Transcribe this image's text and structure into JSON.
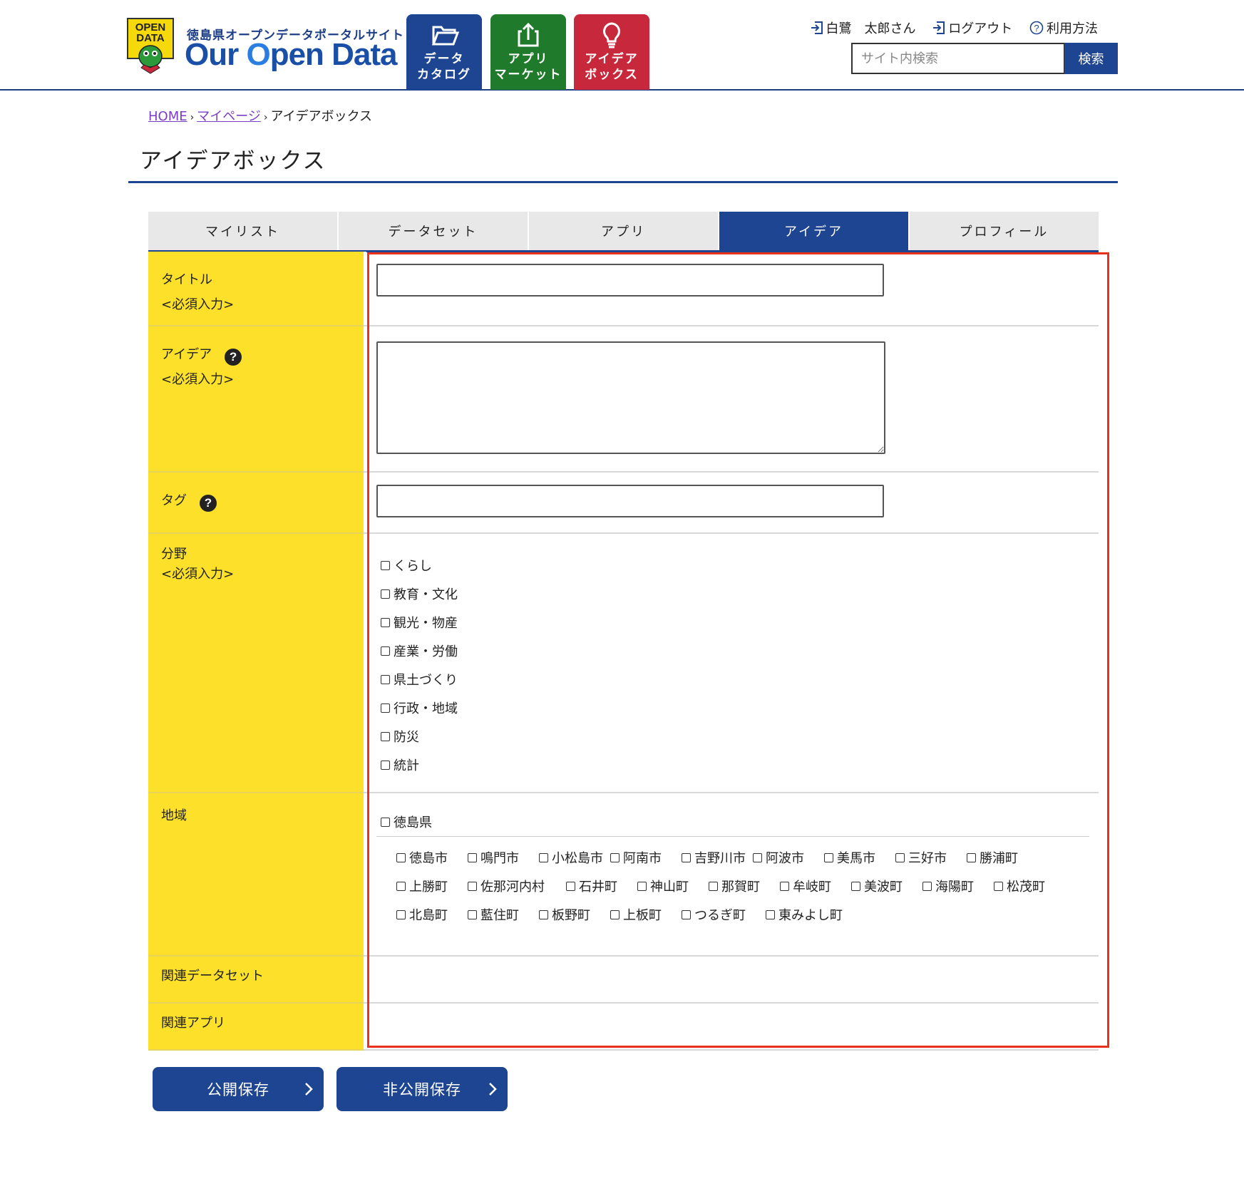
{
  "header": {
    "logo_badge": "OPEN DATA",
    "logo_subtitle": "徳島県オープンデータポータルサイト",
    "logo_title_a": "Our ",
    "logo_title_b": "O",
    "logo_title_c": "pen Data",
    "nav": [
      {
        "label": "データ\nカタログ",
        "icon": "folder-icon",
        "color": "#1d4592"
      },
      {
        "label": "アプリ\nマーケット",
        "icon": "share-icon",
        "color": "#1f7a2c"
      },
      {
        "label": "アイデア\nボックス",
        "icon": "lightbulb-icon",
        "color": "#c8283c"
      }
    ],
    "user_name": "白鷺　太郎さん",
    "logout": "ログアウト",
    "help": "利用方法",
    "search": {
      "placeholder": "サイト内検索",
      "button": "検索"
    }
  },
  "breadcrumb": {
    "home": "HOME",
    "mypage": "マイページ",
    "current": "アイデアボックス"
  },
  "page_title": "アイデアボックス",
  "tabs": [
    "マイリスト",
    "データセット",
    "アプリ",
    "アイデア",
    "プロフィール"
  ],
  "active_tab": "アイデア",
  "form": {
    "title_label": "タイトル",
    "required": "<必須入力>",
    "idea_label": "アイデア",
    "tag_label": "タグ",
    "field_label": "分野",
    "fields": [
      "くらし",
      "教育・文化",
      "観光・物産",
      "産業・労働",
      "県土づくり",
      "行政・地域",
      "防災",
      "統計"
    ],
    "region_label": "地域",
    "prefecture": "徳島県",
    "municipalities": [
      "徳島市",
      "鳴門市",
      "小松島市",
      "阿南市",
      "吉野川市",
      "阿波市",
      "美馬市",
      "三好市",
      "勝浦町",
      "上勝町",
      "佐那河内村",
      "石井町",
      "神山町",
      "那賀町",
      "牟岐町",
      "美波町",
      "海陽町",
      "松茂町",
      "北島町",
      "藍住町",
      "板野町",
      "上板町",
      "つるぎ町",
      "東みよし町"
    ],
    "related_dataset_label": "関連データセット",
    "related_app_label": "関連アプリ"
  },
  "buttons": {
    "public_save": "公開保存",
    "private_save": "非公開保存"
  },
  "colors": {
    "primary": "#1d4592",
    "label_bg": "#fde02a",
    "highlight": "#e8321e",
    "link": "#7a3fc4"
  }
}
